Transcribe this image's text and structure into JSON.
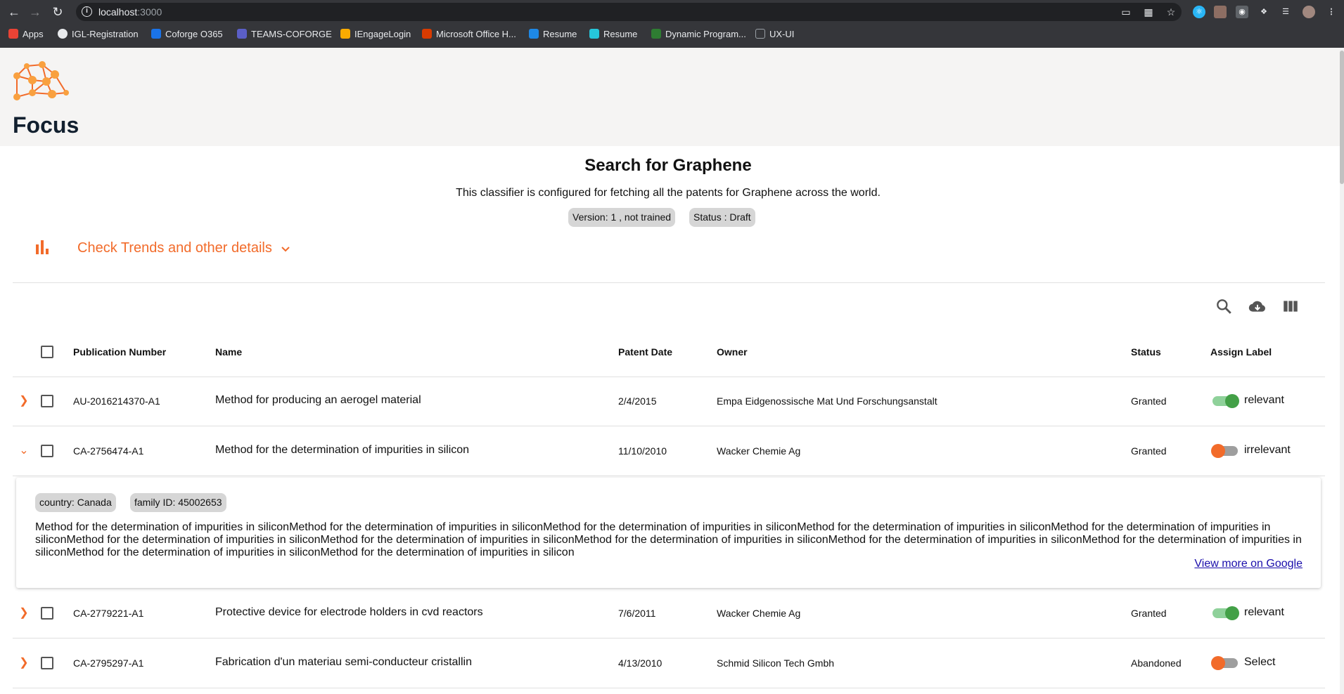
{
  "browser": {
    "url_host": "localhost",
    "url_port": ":3000",
    "bookmarks": [
      {
        "label": "Apps",
        "color": "#ea4335"
      },
      {
        "label": "IGL-Registration",
        "color": "#e8eaed"
      },
      {
        "label": "Coforge O365",
        "color": "#1a73e8"
      },
      {
        "label": "TEAMS-COFORGE",
        "color": "#5b5fc7"
      },
      {
        "label": "IEngageLogin",
        "color": "#f9ab00"
      },
      {
        "label": "Microsoft Office H...",
        "color": "#d83b01"
      },
      {
        "label": "Resume",
        "color": "#1e88e5"
      },
      {
        "label": "Resume",
        "color": "#26c6da"
      },
      {
        "label": "Dynamic Program...",
        "color": "#2e7d32"
      },
      {
        "label": "UX-UI",
        "color": "#9aa0a6"
      }
    ]
  },
  "app": {
    "title": "Focus",
    "accent": "#f26b2a"
  },
  "search": {
    "title": "Search for Graphene",
    "description": "This classifier is configured for fetching all the patents for Graphene across the world.",
    "version_chip": "Version: 1 , not trained",
    "status_chip": "Status : Draft",
    "trends_label": "Check Trends and other details"
  },
  "toolbar": {
    "icons": [
      "search-icon",
      "cloud-download-icon",
      "view-column-icon"
    ]
  },
  "table": {
    "headers": {
      "publication_number": "Publication Number",
      "name": "Name",
      "patent_date": "Patent Date",
      "owner": "Owner",
      "status": "Status",
      "assign_label": "Assign Label"
    },
    "rows": [
      {
        "pub": "AU-2016214370-A1",
        "name": "Method for producing an aerogel material",
        "date": "2/4/2015",
        "owner": "Empa Eidgenossische Mat Und Forschungsanstalt",
        "status": "Granted",
        "label": "relevant",
        "toggle": "on",
        "expanded": false
      },
      {
        "pub": "CA-2756474-A1",
        "name": "Method for the determination of impurities in silicon",
        "date": "11/10/2010",
        "owner": "Wacker Chemie Ag",
        "status": "Granted",
        "label": "irrelevant",
        "toggle": "off",
        "expanded": true
      },
      {
        "pub": "CA-2779221-A1",
        "name": "Protective device for electrode holders in cvd reactors",
        "date": "7/6/2011",
        "owner": "Wacker Chemie Ag",
        "status": "Granted",
        "label": "relevant",
        "toggle": "on",
        "expanded": false
      },
      {
        "pub": "CA-2795297-A1",
        "name": "Fabrication d'un materiau semi-conducteur cristallin",
        "date": "4/13/2010",
        "owner": "Schmid Silicon Tech Gmbh",
        "status": "Abandoned",
        "label": "Select",
        "toggle": "off",
        "expanded": false
      }
    ],
    "detail": {
      "country": "country: Canada",
      "family": "family ID: 45002653",
      "text": "Method for the determination of impurities in siliconMethod for the determination of impurities in siliconMethod for the determination of impurities in siliconMethod for the determination of impurities in siliconMethod for the determination of impurities in siliconMethod for the determination of impurities in siliconMethod for the determination of impurities in siliconMethod for the determination of impurities in siliconMethod for the determination of impurities in siliconMethod for the determination of impurities in siliconMethod for the determination of impurities in siliconMethod for the determination of impurities in silicon",
      "link": "View more on Google"
    }
  }
}
